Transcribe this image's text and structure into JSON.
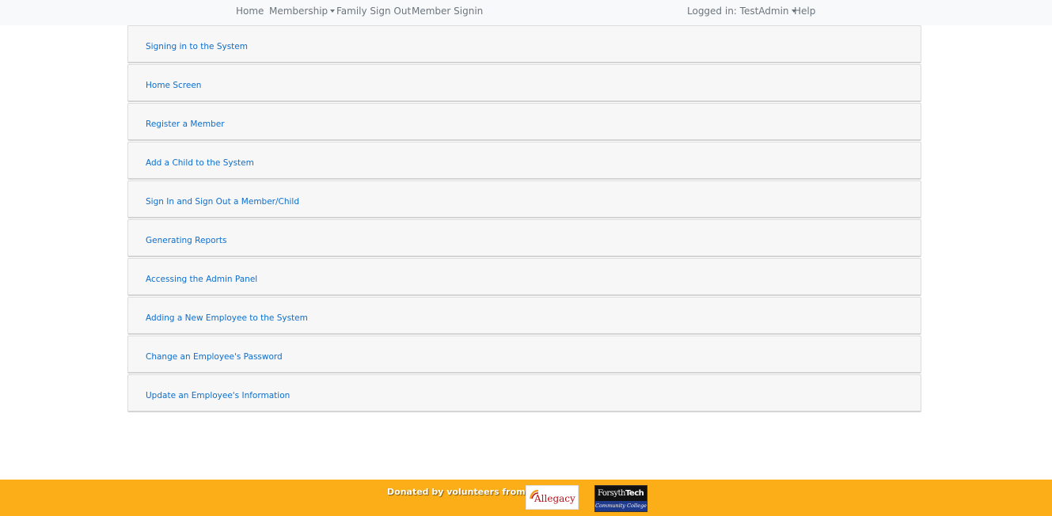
{
  "nav": {
    "home": "Home",
    "membership": "Membership",
    "family_sign_out": "Family Sign Out",
    "member_signin": "Member Signin",
    "logged_in": "Logged in: TestAdmin",
    "help": "Help"
  },
  "accordion": {
    "items": [
      {
        "label": "Signing in to the System"
      },
      {
        "label": "Home Screen"
      },
      {
        "label": "Register a Member"
      },
      {
        "label": "Add a Child to the System"
      },
      {
        "label": "Sign In and Sign Out a Member/Child"
      },
      {
        "label": "Generating Reports"
      },
      {
        "label": "Accessing the Admin Panel"
      },
      {
        "label": "Adding a New Employee to the System"
      },
      {
        "label": "Change an Employee's Password"
      },
      {
        "label": "Update an Employee's Information"
      }
    ]
  },
  "footer": {
    "donated_text": "Donated by volunteers from:",
    "allegacy_logo": "Allegacy",
    "forsyth_logo_main": "Forsyth",
    "forsyth_logo_bold": "Tech",
    "forsyth_logo_sub": "Community College"
  },
  "colors": {
    "footer_bg": "#fbae17",
    "link": "#0d6ecd",
    "nav_bg": "#f8f9fa"
  }
}
